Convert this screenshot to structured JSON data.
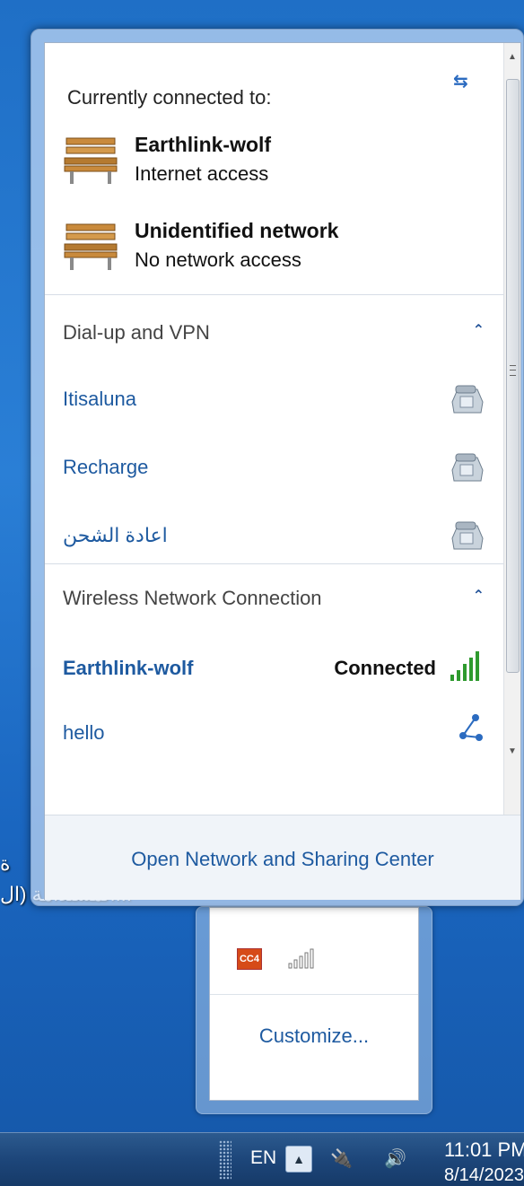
{
  "desktop": {
    "label_line1": "ة",
    "label_line2": "...المستدامة (ال"
  },
  "flyout": {
    "currently_connected_title": "Currently connected to:",
    "connections": [
      {
        "name": "Earthlink-wolf",
        "status": "Internet access"
      },
      {
        "name": "Unidentified network",
        "status": "No network access"
      }
    ],
    "groups": {
      "dialup": {
        "title": "Dial-up and VPN",
        "items": [
          "Itisaluna",
          "Recharge",
          "اعادة الشحن"
        ]
      },
      "wireless": {
        "title": "Wireless Network Connection",
        "items": [
          {
            "name": "Earthlink-wolf",
            "status": "Connected"
          },
          {
            "name": "hello"
          }
        ]
      }
    },
    "footer_link": "Open Network and Sharing Center"
  },
  "overflow": {
    "cc_icon_text": "CC4",
    "customize_link": "Customize..."
  },
  "taskbar": {
    "language": "EN",
    "time": "11:01 PM",
    "date": "8/14/2023"
  },
  "colors": {
    "link_blue": "#1e5aa0",
    "signal_green": "#2e9a2e",
    "desktop_blue": "#1f6fc6"
  }
}
